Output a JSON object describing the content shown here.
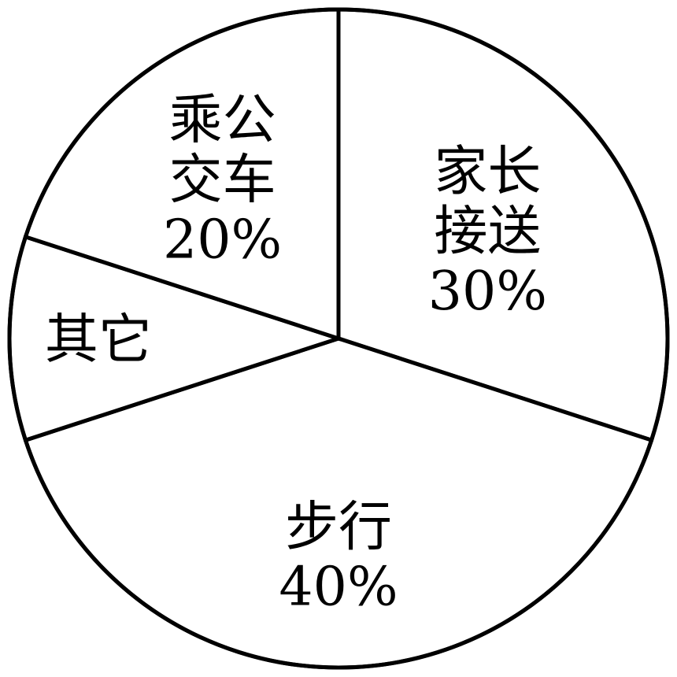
{
  "chart_data": {
    "type": "pie",
    "title": "",
    "slices": [
      {
        "label_lines": [
          "家长",
          "接送"
        ],
        "value_label": "30%",
        "value": 30
      },
      {
        "label_lines": [
          "步行"
        ],
        "value_label": "40%",
        "value": 40
      },
      {
        "label_lines": [
          "其它"
        ],
        "value_label": "",
        "value": 10
      },
      {
        "label_lines": [
          "乘公",
          "交车"
        ],
        "value_label": "20%",
        "value": 20
      }
    ],
    "start_angle_deg": 0,
    "direction": "clockwise",
    "legend": "none",
    "colors": {
      "fill": "#ffffff",
      "stroke": "#000000"
    }
  }
}
